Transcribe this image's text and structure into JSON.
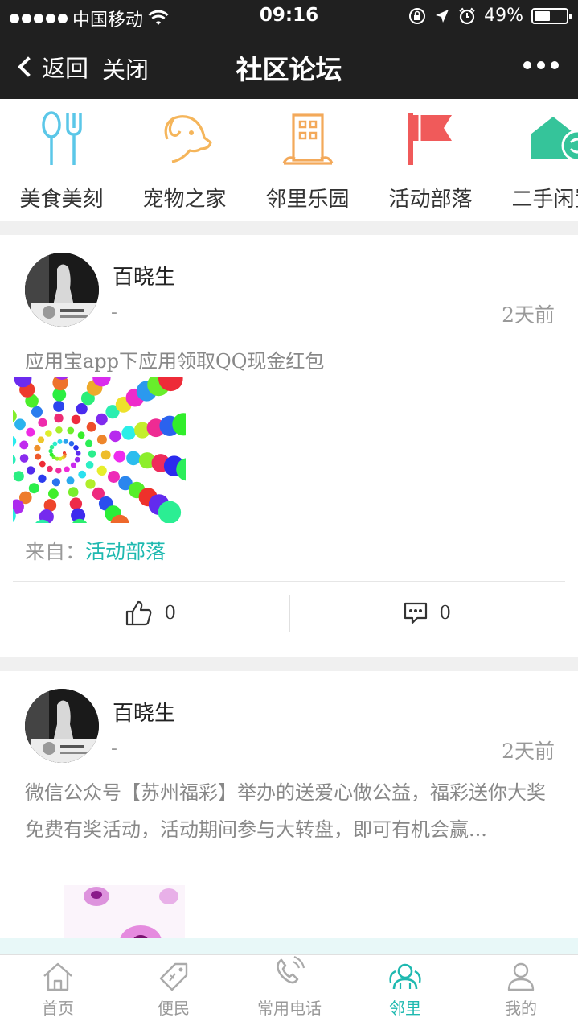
{
  "status": {
    "carrier": "中国移动",
    "time": "09:16",
    "battery_pct": "49%",
    "battery_level": 0.49
  },
  "nav": {
    "back_label": "返回",
    "close_label": "关闭",
    "title": "社区论坛"
  },
  "categories": [
    {
      "label": "美食美刻",
      "icon": "utensils-icon",
      "color": "#5bc7e8"
    },
    {
      "label": "宠物之家",
      "icon": "dog-icon",
      "color": "#f5b55a"
    },
    {
      "label": "邻里乐园",
      "icon": "building-icon",
      "color": "#f3a95a"
    },
    {
      "label": "活动部落",
      "icon": "flag-icon",
      "color": "#f05a5a"
    },
    {
      "label": "二手闲置",
      "icon": "house-exchange-icon",
      "color": "#35c49a"
    }
  ],
  "posts": [
    {
      "author": "百晓生",
      "subtitle": "-",
      "time_ago": "2天前",
      "text": "应用宝app下应用领取QQ现金红包",
      "from_label": "来自：",
      "from_category": "活动部落",
      "likes": "0",
      "comments": "0"
    },
    {
      "author": "百晓生",
      "subtitle": "-",
      "time_ago": "2天前",
      "text": "微信公众号【苏州福彩】举办的送爱心做公益，福彩送你大奖免费有奖活动，活动期间参与大转盘，即可有机会赢..."
    }
  ],
  "tabs": [
    {
      "label": "首页",
      "icon": "home-icon"
    },
    {
      "label": "便民",
      "icon": "tag-icon"
    },
    {
      "label": "常用电话",
      "icon": "phone-icon"
    },
    {
      "label": "邻里",
      "icon": "neighbors-icon",
      "active": true
    },
    {
      "label": "我的",
      "icon": "user-icon"
    }
  ],
  "colors": {
    "accent": "#1fb9b0",
    "navbar": "#202020"
  }
}
